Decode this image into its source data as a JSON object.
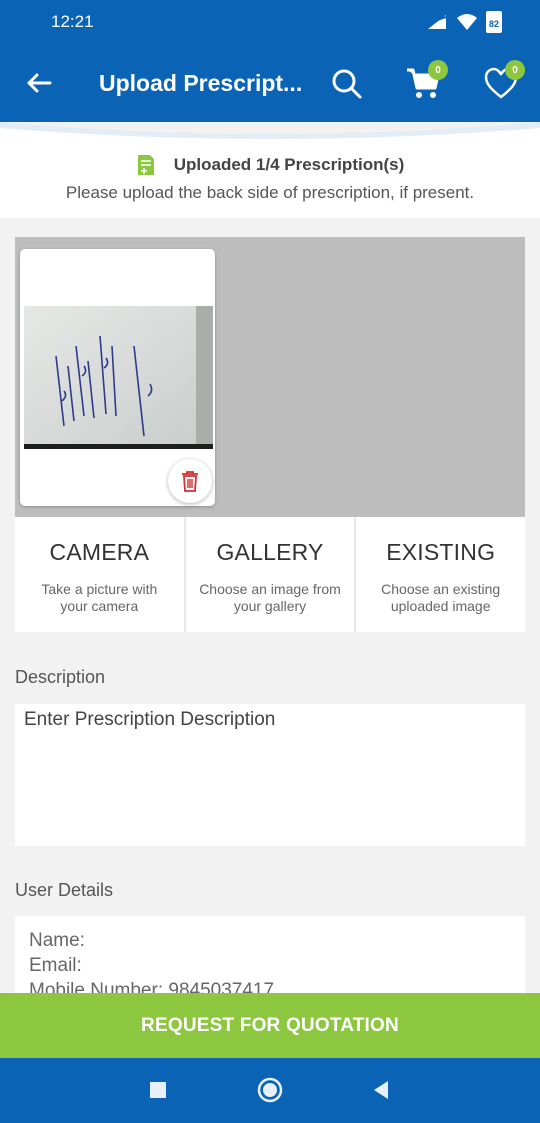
{
  "status_bar": {
    "time": "12:21",
    "battery": "82"
  },
  "app_bar": {
    "title": "Upload Prescript...",
    "cart_count": "0",
    "wishlist_count": "0"
  },
  "upload_info": {
    "title": "Uploaded 1/4 Prescription(s)",
    "subtitle": "Please upload the back side of prescription, if present."
  },
  "options": [
    {
      "title": "CAMERA",
      "desc": "Take a picture with your camera"
    },
    {
      "title": "GALLERY",
      "desc": "Choose an image from your gallery"
    },
    {
      "title": "EXISTING",
      "desc": "Choose an existing uploaded image"
    }
  ],
  "description": {
    "label": "Description",
    "placeholder": "Enter Prescription Description"
  },
  "user_details": {
    "label": "User Details",
    "name_line": "Name:",
    "email_line": "Email:",
    "mobile_line": "Mobile Number: 9845037417"
  },
  "cta": {
    "label": "REQUEST FOR QUOTATION"
  },
  "colors": {
    "primary": "#0a63b5",
    "accent": "#8dc63f"
  }
}
